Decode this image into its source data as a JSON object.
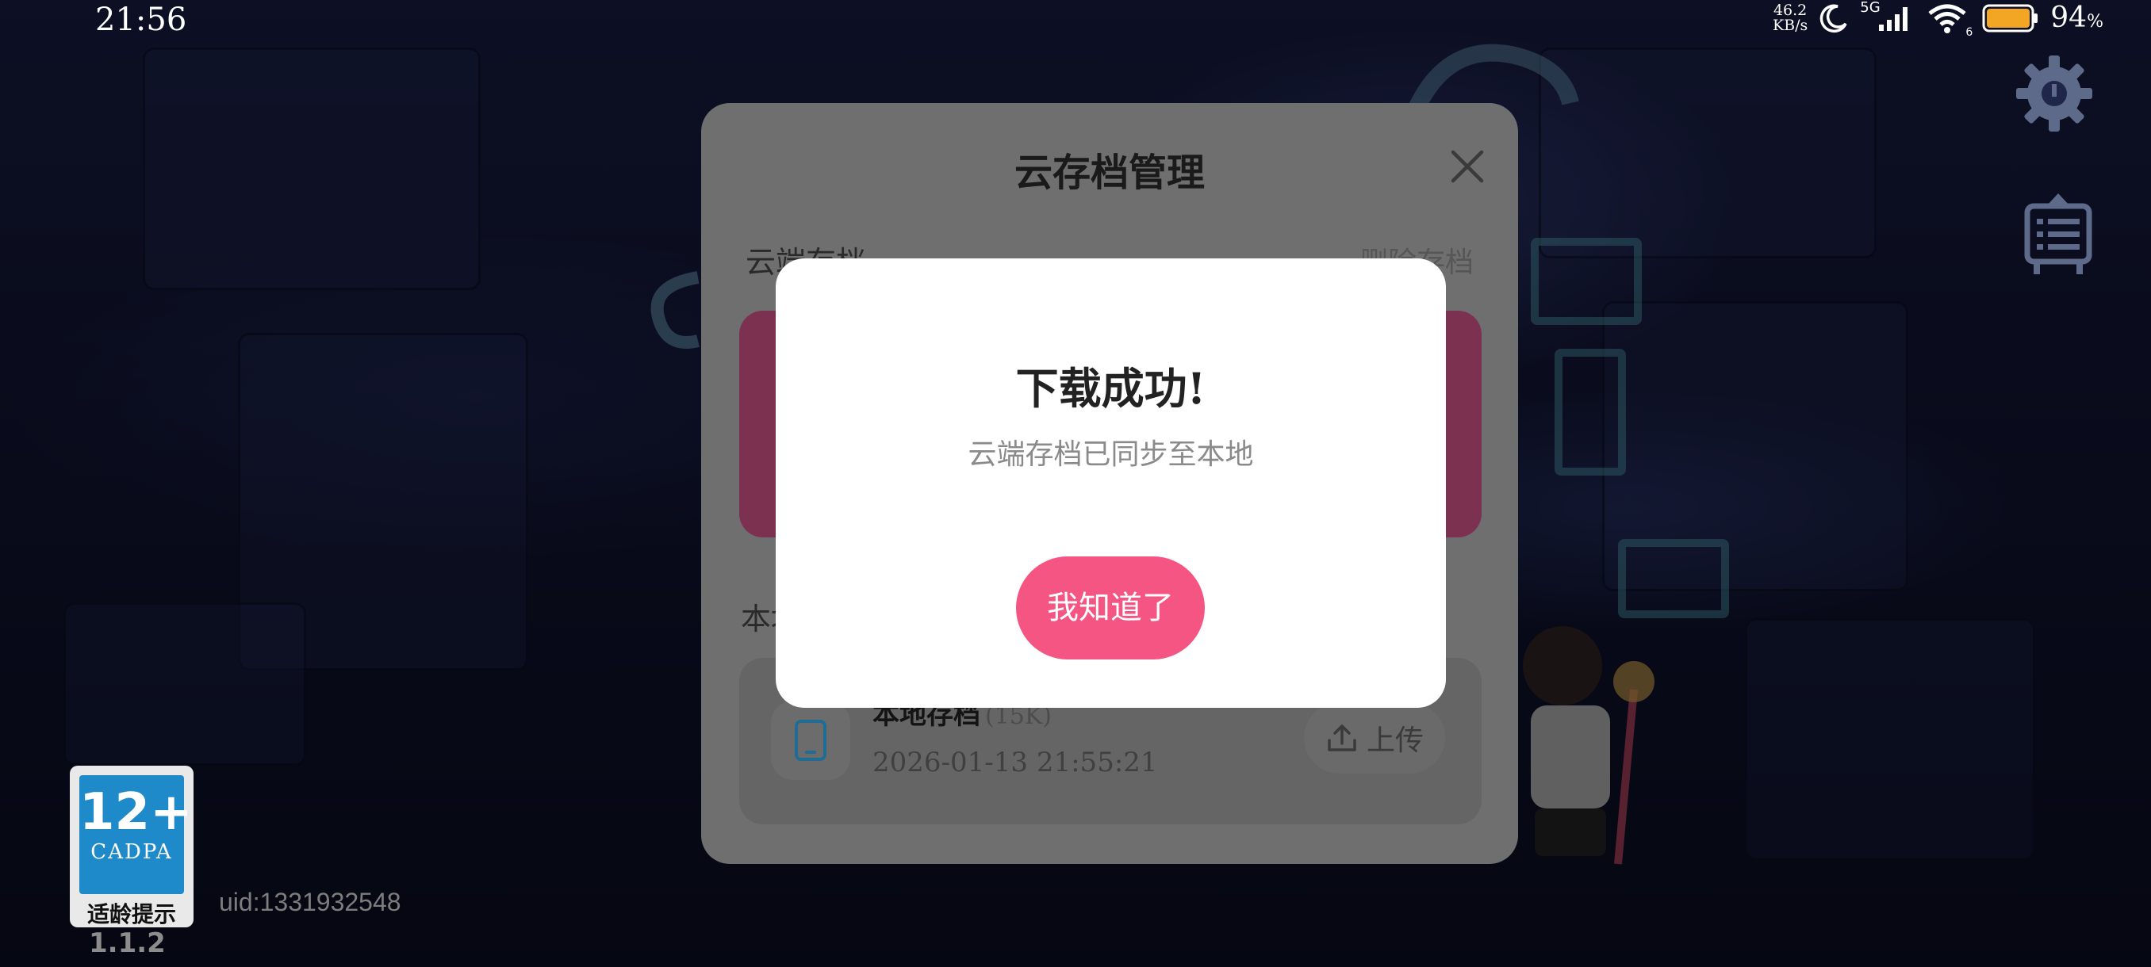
{
  "status_bar": {
    "time": "21:56",
    "net_speed_value": "46.2",
    "net_speed_unit": "KB/s",
    "network_type": "5G",
    "wifi_badge": "6",
    "battery": "94",
    "battery_unit": "%"
  },
  "side_icons": [
    "gear-icon",
    "notice-board-icon"
  ],
  "age_rating": {
    "age": "12+",
    "org": "CADPA",
    "tip": "适龄提示"
  },
  "version": "1.1.2",
  "uid": "uid:1331932548",
  "save_panel": {
    "title": "云存档管理",
    "cloud_label": "云端存档",
    "delete_label": "删除存档",
    "local_label": "本地存档",
    "local_card": {
      "name": "本地存档",
      "size": "(15K)",
      "date": "2026-01-13 21:55:21",
      "upload_label": "上传"
    }
  },
  "dialog": {
    "title": "下载成功!",
    "message": "云端存档已同步至本地",
    "confirm_label": "我知道了"
  },
  "colors": {
    "accent": "#f45582",
    "cloud_card": "#7c3150",
    "device_icon": "#1e8ac9"
  }
}
